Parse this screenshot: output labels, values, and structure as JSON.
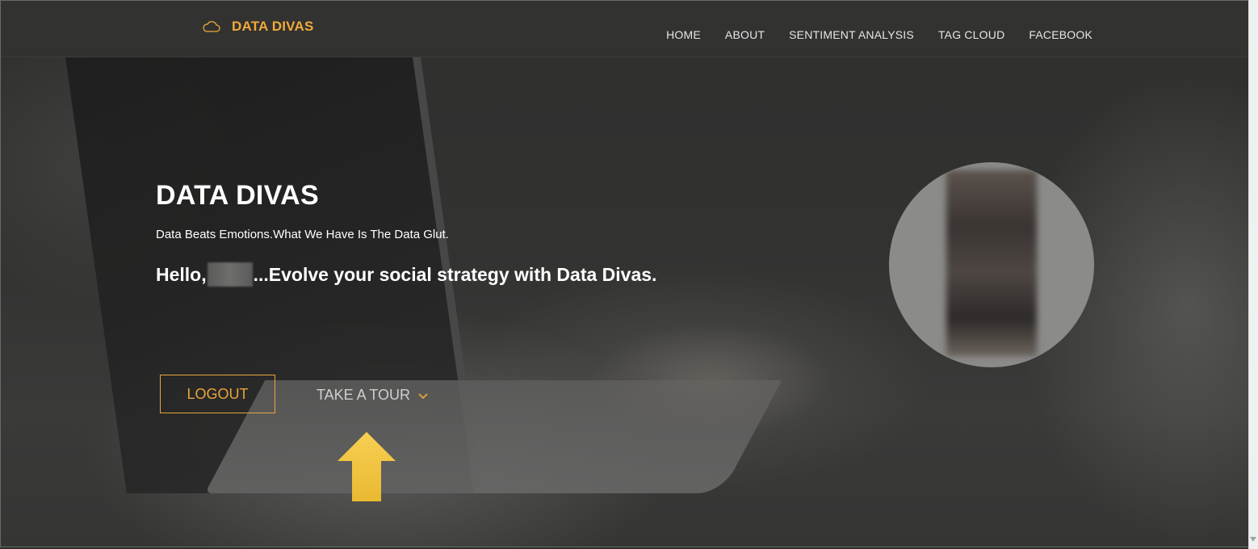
{
  "brand": {
    "name": "DATA DIVAS",
    "icon": "cloud-icon",
    "color": "#f0a93b"
  },
  "nav": [
    {
      "label": "HOME"
    },
    {
      "label": "ABOUT"
    },
    {
      "label": "SENTIMENT ANALYSIS"
    },
    {
      "label": "TAG CLOUD"
    },
    {
      "label": "FACEBOOK"
    }
  ],
  "hero": {
    "title": "DATA DIVAS",
    "tagline": "Data Beats Emotions.What We Have Is The Data Glut.",
    "greeting_prefix": "Hello,",
    "greeting_suffix": "...Evolve your social strategy with Data Divas."
  },
  "actions": {
    "logout_label": "LOGOUT",
    "tour_label": "TAKE A TOUR",
    "tour_icon": "chevron-down-icon"
  },
  "colors": {
    "accent": "#e8a53a",
    "pointer_arrow": "#f2c440"
  }
}
